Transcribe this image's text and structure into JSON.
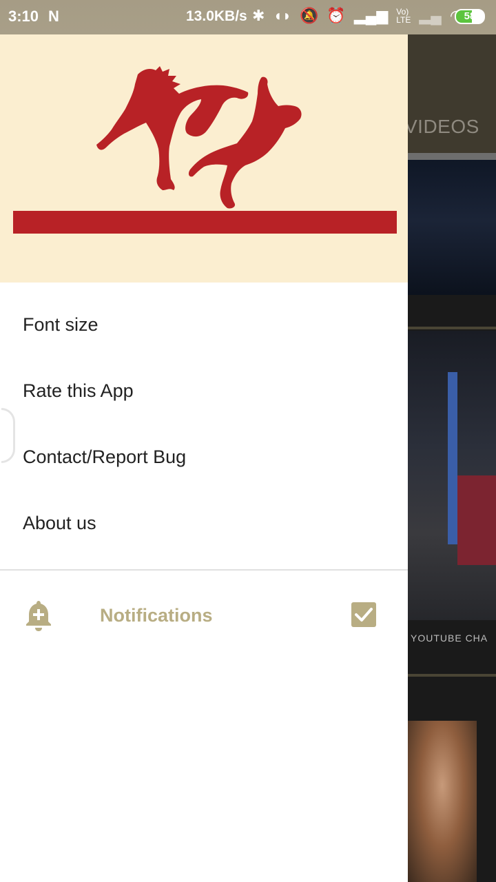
{
  "status_bar": {
    "time": "3:10",
    "network_speed": "13.0KB/s",
    "battery_level": "58",
    "battery_fraction": 0.58,
    "icons": [
      "notification-n-icon",
      "bluetooth-icon",
      "toggle-icon",
      "mute-icon",
      "alarm-icon",
      "signal-icon",
      "volte-icon",
      "wifi-icon",
      "battery-icon"
    ]
  },
  "background_app": {
    "tab_label": "VIDEOS",
    "channel_caption": "YOUTUBE CHA"
  },
  "drawer": {
    "logo_icon": "wrestlers-logo-icon",
    "menu_items": [
      {
        "label": "Font size"
      },
      {
        "label": "Rate this App"
      },
      {
        "label": "Contact/Report Bug"
      },
      {
        "label": "About us"
      }
    ],
    "notifications": {
      "label": "Notifications",
      "checked": true,
      "icon": "bell-add-icon"
    }
  },
  "colors": {
    "accent": "#b8ad83",
    "header_bg": "#fbeed0",
    "logo_red": "#b82226",
    "status_bar": "#a69c85"
  }
}
